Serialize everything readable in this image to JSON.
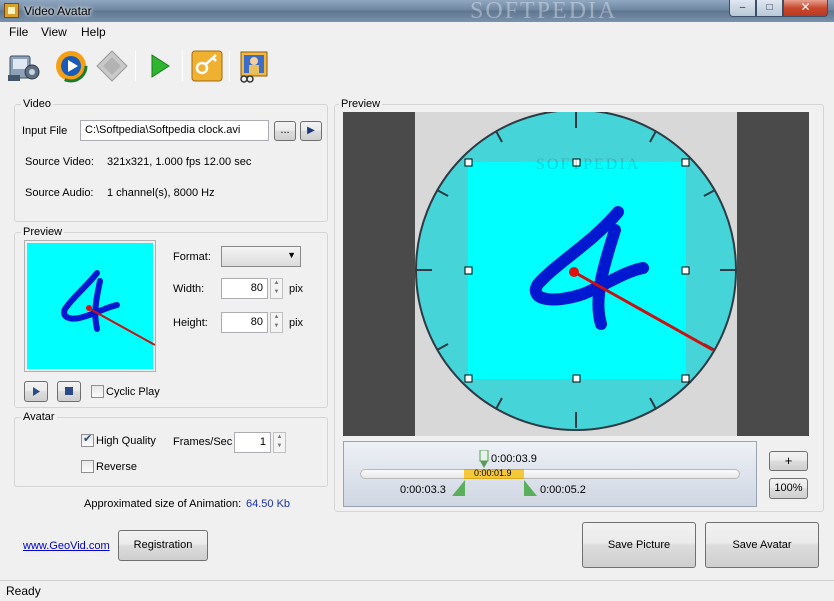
{
  "window": {
    "title": "Video Avatar",
    "watermark": "SOFTPEDIA",
    "min": "–",
    "max": "□",
    "close": "✕"
  },
  "menu": [
    "File",
    "View",
    "Help"
  ],
  "toolbar": {
    "buttons": [
      "open-icon",
      "play-media-icon",
      "stop-disc-icon",
      "play-icon",
      "key-icon",
      "avatar-cut-icon"
    ]
  },
  "video": {
    "group_label": "Video",
    "input_file_label": "Input File",
    "input_file_value": "C:\\Softpedia\\Softpedia clock.avi",
    "browse_label": "...",
    "play_label": "▶",
    "source_video_label": "Source Video:",
    "source_video_value": "321x321, 1.000 fps 12.00 sec",
    "source_audio_label": "Source Audio:",
    "source_audio_value": "1 channel(s), 8000 Hz"
  },
  "preview_small": {
    "group_label": "Preview",
    "format_label": "Format:",
    "format_value": "",
    "width_label": "Width:",
    "width_value": "80",
    "height_label": "Height:",
    "height_value": "80",
    "unit": "pix",
    "cyclic_label": "Cyclic Play",
    "cyclic_checked": false
  },
  "avatar": {
    "group_label": "Avatar",
    "high_quality_label": "High Quality",
    "high_quality_checked": true,
    "reverse_label": "Reverse",
    "reverse_checked": false,
    "fps_label": "Frames/Sec",
    "fps_value": "1"
  },
  "approx": {
    "label": "Approximated size of Animation:",
    "value": "64.50 Kb"
  },
  "footer": {
    "link": "www.GeoVid.com",
    "registration": "Registration",
    "save_picture": "Save Picture",
    "save_avatar": "Save Avatar"
  },
  "preview_big": {
    "group_label": "Preview",
    "watermark": "SOFTPEDIA"
  },
  "timeline": {
    "current": "0:00:03.9",
    "duration": "0:00:01.9",
    "start": "0:00:03.3",
    "end": "0:00:05.2",
    "zoom_in": "+",
    "zoom": "100%"
  },
  "status": {
    "text": "Ready"
  },
  "colors": {
    "cyan": "#00ffff",
    "teal": "#45d5d8",
    "digit": "#0018d0",
    "hand": "#cc1010"
  }
}
